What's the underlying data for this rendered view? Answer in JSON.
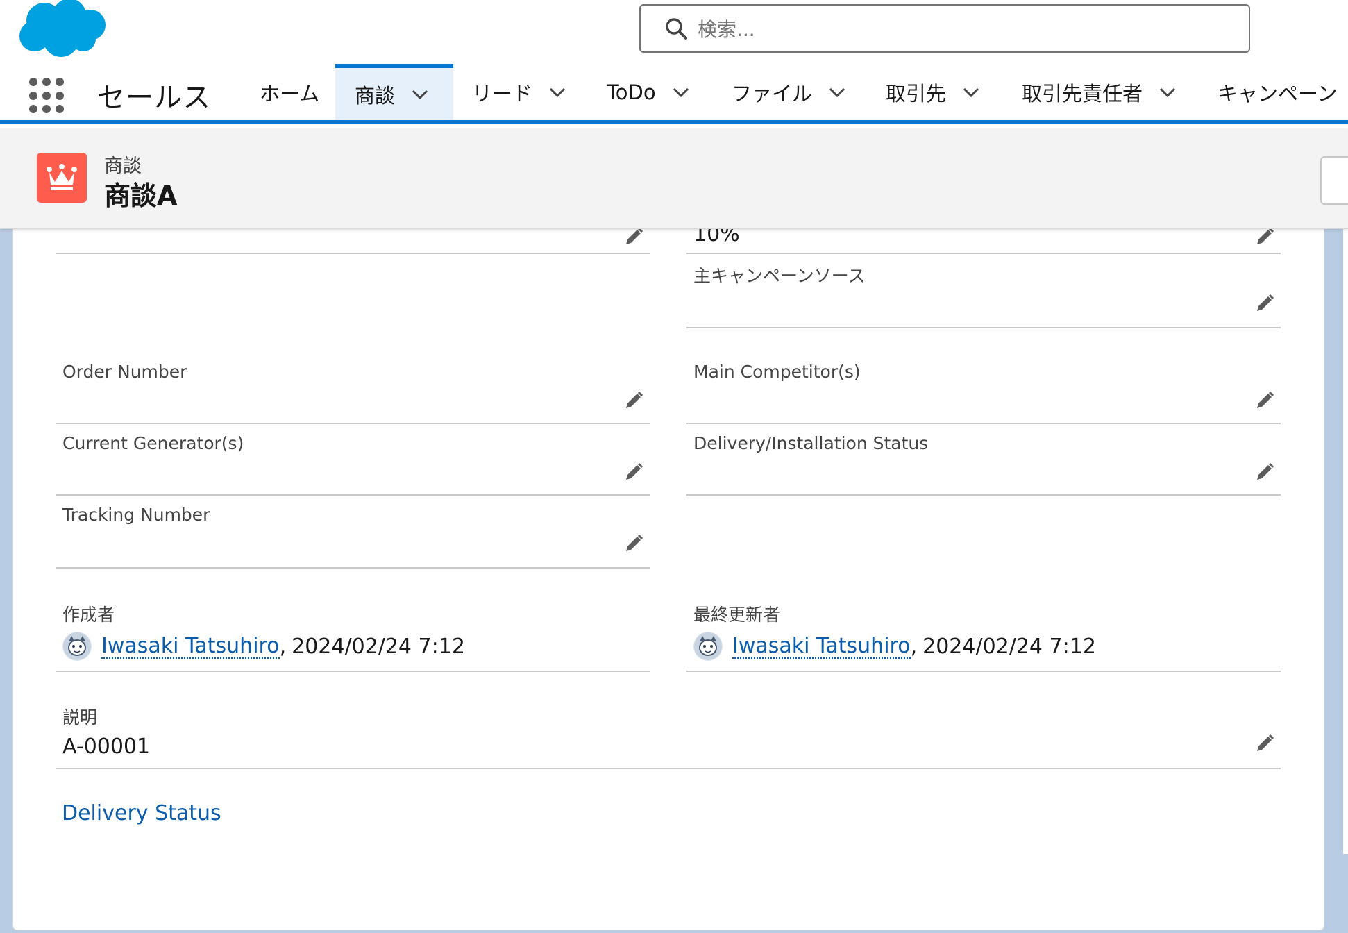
{
  "search": {
    "placeholder": "検索..."
  },
  "app": {
    "name": "セールス"
  },
  "nav": {
    "items": [
      {
        "label": "ホーム",
        "has_menu": false,
        "active": false
      },
      {
        "label": "商談",
        "has_menu": true,
        "active": true
      },
      {
        "label": "リード",
        "has_menu": true,
        "active": false
      },
      {
        "label": "ToDo",
        "has_menu": true,
        "active": false
      },
      {
        "label": "ファイル",
        "has_menu": true,
        "active": false
      },
      {
        "label": "取引先",
        "has_menu": true,
        "active": false
      },
      {
        "label": "取引先責任者",
        "has_menu": true,
        "active": false
      },
      {
        "label": "キャンペーン",
        "has_menu": false,
        "active": false
      }
    ]
  },
  "record": {
    "type_label": "商談",
    "name": "商談A",
    "icon": "crown-icon",
    "icon_color": "#fe5c4c"
  },
  "fields": {
    "top_right_value": "10%",
    "primary_campaign_source": {
      "label": "主キャンペーンソース",
      "value": ""
    },
    "order_number": {
      "label": "Order Number",
      "value": ""
    },
    "main_competitors": {
      "label": "Main Competitor(s)",
      "value": ""
    },
    "current_generators": {
      "label": "Current Generator(s)",
      "value": ""
    },
    "delivery_installation_status": {
      "label": "Delivery/Installation Status",
      "value": ""
    },
    "tracking_number": {
      "label": "Tracking Number",
      "value": ""
    },
    "created_by": {
      "label": "作成者",
      "user": "Iwasaki Tatsuhiro",
      "separator": ",",
      "date": "2024/02/24 7:12"
    },
    "last_modified_by": {
      "label": "最終更新者",
      "user": "Iwasaki Tatsuhiro",
      "separator": ",",
      "date": "2024/02/24 7:12"
    },
    "description": {
      "label": "説明",
      "value": "A-00001"
    }
  },
  "section_link": "Delivery Status",
  "colors": {
    "brand_blue": "#0176d3",
    "link": "#0b5cab",
    "salesforce_cloud": "#00a1e0"
  }
}
